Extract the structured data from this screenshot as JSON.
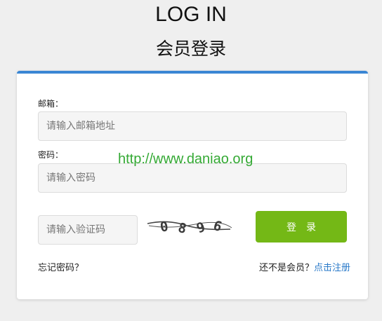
{
  "header": {
    "title_en": "LOG IN",
    "title_cn": "会员登录"
  },
  "form": {
    "email_label": "邮箱：",
    "email_placeholder": "请输入邮箱地址",
    "password_label": "密码：",
    "password_placeholder": "请输入密码",
    "captcha_placeholder": "请输入验证码",
    "captcha_text": "0896",
    "login_label": "登录",
    "forgot_label": "忘记密码？",
    "not_member_text": "还不是会员？",
    "register_link": "点击注册"
  },
  "watermark": "http://www.daniao.org",
  "colors": {
    "accent_bar": "#3a86d4",
    "login_button": "#74b816",
    "link": "#2a7ac9",
    "watermark": "#34a934"
  }
}
